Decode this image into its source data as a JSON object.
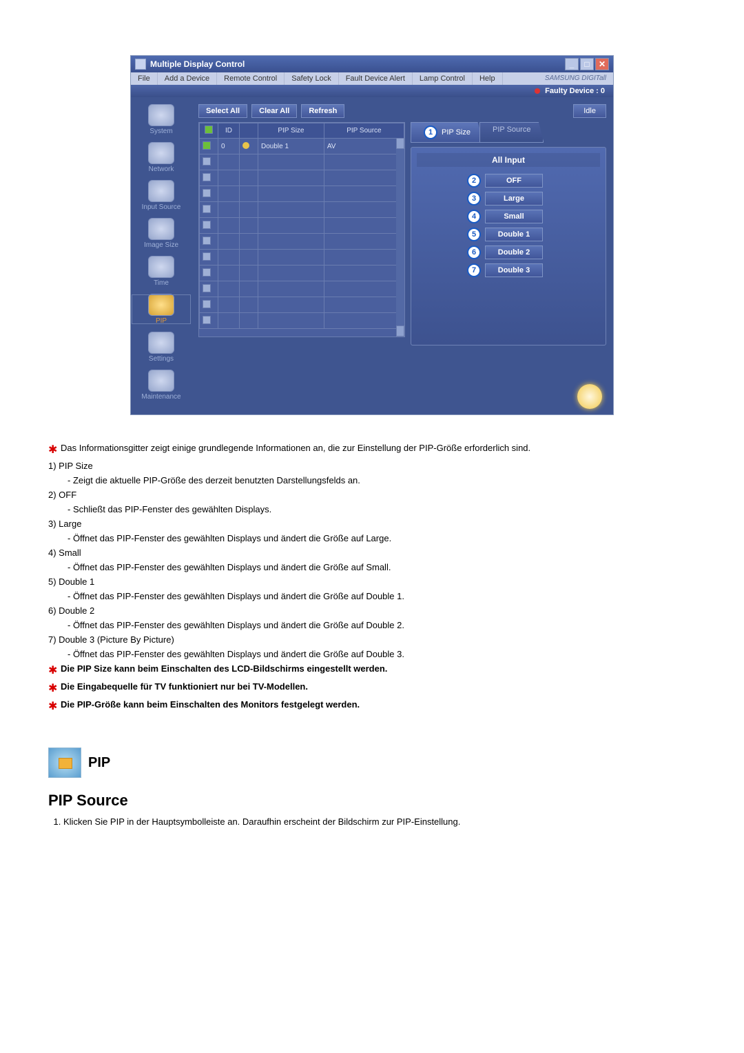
{
  "window": {
    "title": "Multiple Display Control",
    "brand": "SAMSUNG DIGITall"
  },
  "menu": {
    "file": "File",
    "add": "Add a Device",
    "remote": "Remote Control",
    "safety": "Safety Lock",
    "fault": "Fault Device Alert",
    "lamp": "Lamp Control",
    "help": "Help"
  },
  "status": {
    "faulty": "Faulty Device : 0"
  },
  "sidebar": {
    "system": "System",
    "network": "Network",
    "inputsource": "Input Source",
    "imagesize": "Image Size",
    "time": "Time",
    "pip": "PIP",
    "settings": "Settings",
    "maintenance": "Maintenance"
  },
  "toolbar": {
    "selectall": "Select All",
    "clearall": "Clear All",
    "refresh": "Refresh",
    "idle": "Idle"
  },
  "grid": {
    "cols": {
      "id": "ID",
      "pipsize": "PIP Size",
      "pipsource": "PIP Source"
    },
    "row1": {
      "id": "0",
      "pipsize": "Double 1",
      "pipsource": "AV"
    }
  },
  "tabs": {
    "size": "PIP Size",
    "source": "PIP Source"
  },
  "panel": {
    "header": "All Input",
    "off": "OFF",
    "large": "Large",
    "small": "Small",
    "d1": "Double 1",
    "d2": "Double 2",
    "d3": "Double 3"
  },
  "badges": {
    "b1": "1",
    "b2": "2",
    "b3": "3",
    "b4": "4",
    "b5": "5",
    "b6": "6",
    "b7": "7"
  },
  "text": {
    "intro": "Das Informationsgitter zeigt einige grundlegende Informationen an, die zur Einstellung der PIP-Größe erforderlich sind.",
    "l1": "1)  PIP Size",
    "l1a": "- Zeigt die aktuelle PIP-Größe des derzeit benutzten Darstellungsfelds an.",
    "l2": "2)  OFF",
    "l2a": "- Schließt das PIP-Fenster des gewählten Displays.",
    "l3": "3)  Large",
    "l3a": "- Öffnet das PIP-Fenster des gewählten Displays und ändert die Größe auf Large.",
    "l4": "4)  Small",
    "l4a": "- Öffnet das PIP-Fenster des gewählten Displays und ändert die Größe auf Small.",
    "l5": "5)  Double 1",
    "l5a": "- Öffnet das PIP-Fenster des gewählten Displays und ändert die Größe auf Double 1.",
    "l6": "6)  Double 2",
    "l6a": "- Öffnet das PIP-Fenster des gewählten Displays und ändert die Größe auf Double 2.",
    "l7": "7)  Double 3 (Picture By Picture)",
    "l7a": "- Öffnet das PIP-Fenster des gewählten Displays und ändert die Größe auf Double 3.",
    "n1": "Die PIP Size kann beim Einschalten des LCD-Bildschirms eingestellt werden.",
    "n2": "Die Eingabequelle für TV funktioniert nur bei TV-Modellen.",
    "n3": "Die PIP-Größe kann beim Einschalten des Monitors festgelegt werden."
  },
  "section": {
    "pip": "PIP",
    "source": "PIP Source",
    "step1": "Klicken Sie PIP in der Hauptsymbolleiste an. Daraufhin erscheint der Bildschirm zur PIP-Einstellung."
  }
}
